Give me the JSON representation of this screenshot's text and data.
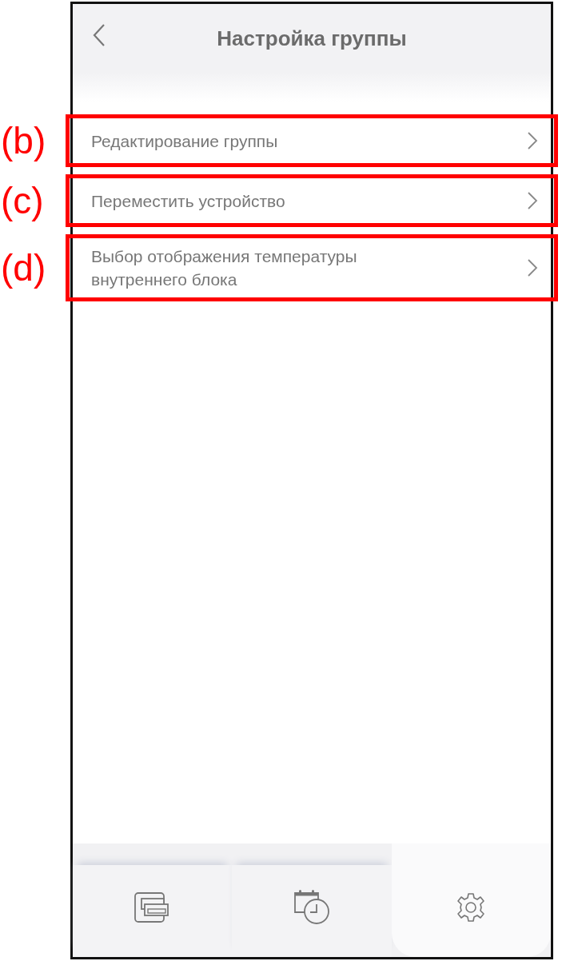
{
  "header": {
    "title": "Настройка группы"
  },
  "menu_items": [
    {
      "label": "Редактирование группы",
      "annotation": "(b)"
    },
    {
      "label": "Переместить устройство",
      "annotation": "(c)"
    },
    {
      "label": "Выбор отображения температуры внутреннего блока",
      "annotation": "(d)"
    }
  ],
  "tabs": [
    {
      "kind": "devices",
      "selected": false
    },
    {
      "kind": "schedule",
      "selected": false
    },
    {
      "kind": "settings",
      "selected": true
    }
  ]
}
